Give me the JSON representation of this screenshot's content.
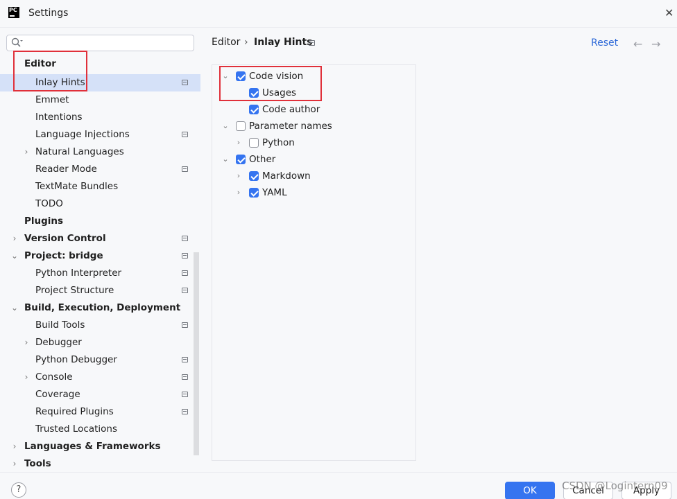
{
  "window": {
    "title": "Settings",
    "logo_text": "PC"
  },
  "search": {
    "placeholder": "",
    "value": ""
  },
  "sidebar": {
    "items": [
      {
        "label": "Editor"
      },
      {
        "label": "Inlay Hints"
      },
      {
        "label": "Emmet"
      },
      {
        "label": "Intentions"
      },
      {
        "label": "Language Injections"
      },
      {
        "label": "Natural Languages"
      },
      {
        "label": "Reader Mode"
      },
      {
        "label": "TextMate Bundles"
      },
      {
        "label": "TODO"
      },
      {
        "label": "Plugins"
      },
      {
        "label": "Version Control"
      },
      {
        "label": "Project: bridge"
      },
      {
        "label": "Python Interpreter"
      },
      {
        "label": "Project Structure"
      },
      {
        "label": "Build, Execution, Deployment"
      },
      {
        "label": "Build Tools"
      },
      {
        "label": "Debugger"
      },
      {
        "label": "Python Debugger"
      },
      {
        "label": "Console"
      },
      {
        "label": "Coverage"
      },
      {
        "label": "Required Plugins"
      },
      {
        "label": "Trusted Locations"
      },
      {
        "label": "Languages & Frameworks"
      },
      {
        "label": "Tools"
      }
    ],
    "selected": "Inlay Hints"
  },
  "breadcrumb": {
    "parent": "Editor",
    "separator": "›",
    "current": "Inlay Hints"
  },
  "header": {
    "reset_label": "Reset",
    "back_arrow": "←",
    "forward_arrow": "→"
  },
  "hints": [
    {
      "label": "Code vision",
      "checked": true,
      "expanded": true
    },
    {
      "label": "Usages",
      "checked": true
    },
    {
      "label": "Code author",
      "checked": true
    },
    {
      "label": "Parameter names",
      "checked": false,
      "expanded": true
    },
    {
      "label": "Python",
      "checked": false,
      "expanded": false
    },
    {
      "label": "Other",
      "checked": true,
      "expanded": true
    },
    {
      "label": "Markdown",
      "checked": true,
      "expanded": false
    },
    {
      "label": "YAML",
      "checked": true,
      "expanded": false
    }
  ],
  "footer": {
    "help_label": "?",
    "ok_label": "OK",
    "cancel_label": "Cancel",
    "apply_label": "Apply",
    "watermark": "CSDN @Logintern09"
  },
  "colors": {
    "accent": "#3574f0",
    "selection": "#d5e1f8",
    "highlight_box": "#e0303a",
    "link": "#2f6ad8"
  },
  "icons": {
    "chevron_right": "›",
    "chevron_down": "⌄"
  }
}
